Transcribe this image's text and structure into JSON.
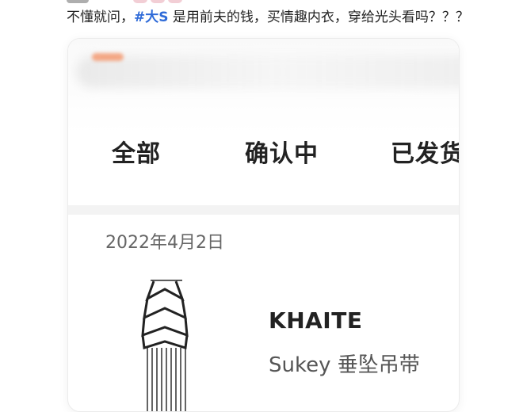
{
  "post": {
    "text_before": "不懂就问，",
    "hashtag": "#大S",
    "text_after": " 是用前夫的钱，买情趣内衣，穿给光头看吗？？？"
  },
  "tabs": [
    {
      "label": "全部"
    },
    {
      "label": "确认中"
    },
    {
      "label": "已发货"
    }
  ],
  "order": {
    "date": "2022年4月2日",
    "brand": "KHAITE",
    "product_name": "Sukey 垂坠吊带"
  },
  "colors": {
    "hashtag": "#2f6bd8",
    "divider": "#f3f3f3"
  }
}
